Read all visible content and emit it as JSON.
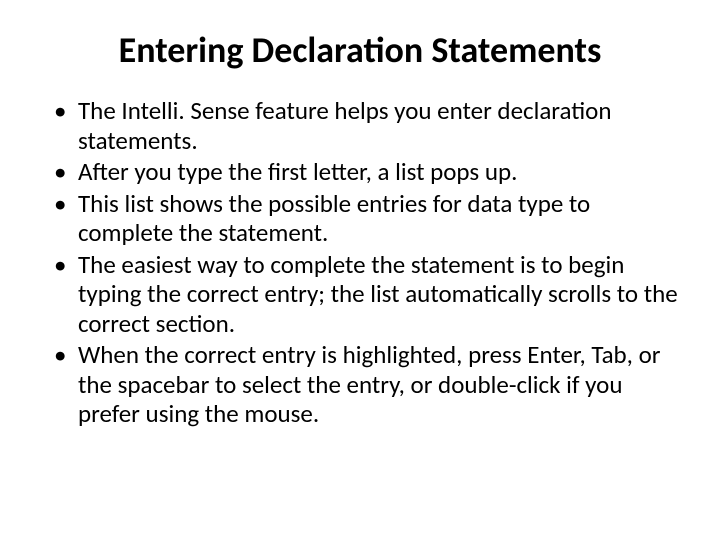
{
  "slide": {
    "title": "Entering Declaration Statements",
    "bullets": [
      "The Intelli. Sense feature helps you enter declaration statements.",
      "After you type the first letter, a list pops up.",
      "This list shows the possible entries for data type to complete the statement.",
      "The easiest way to complete the statement is to begin typing the correct entry; the list automatically scrolls to the correct section.",
      "When the correct entry is highlighted, press Enter, Tab, or the spacebar to select the entry, or double-click if you prefer using the mouse."
    ]
  }
}
